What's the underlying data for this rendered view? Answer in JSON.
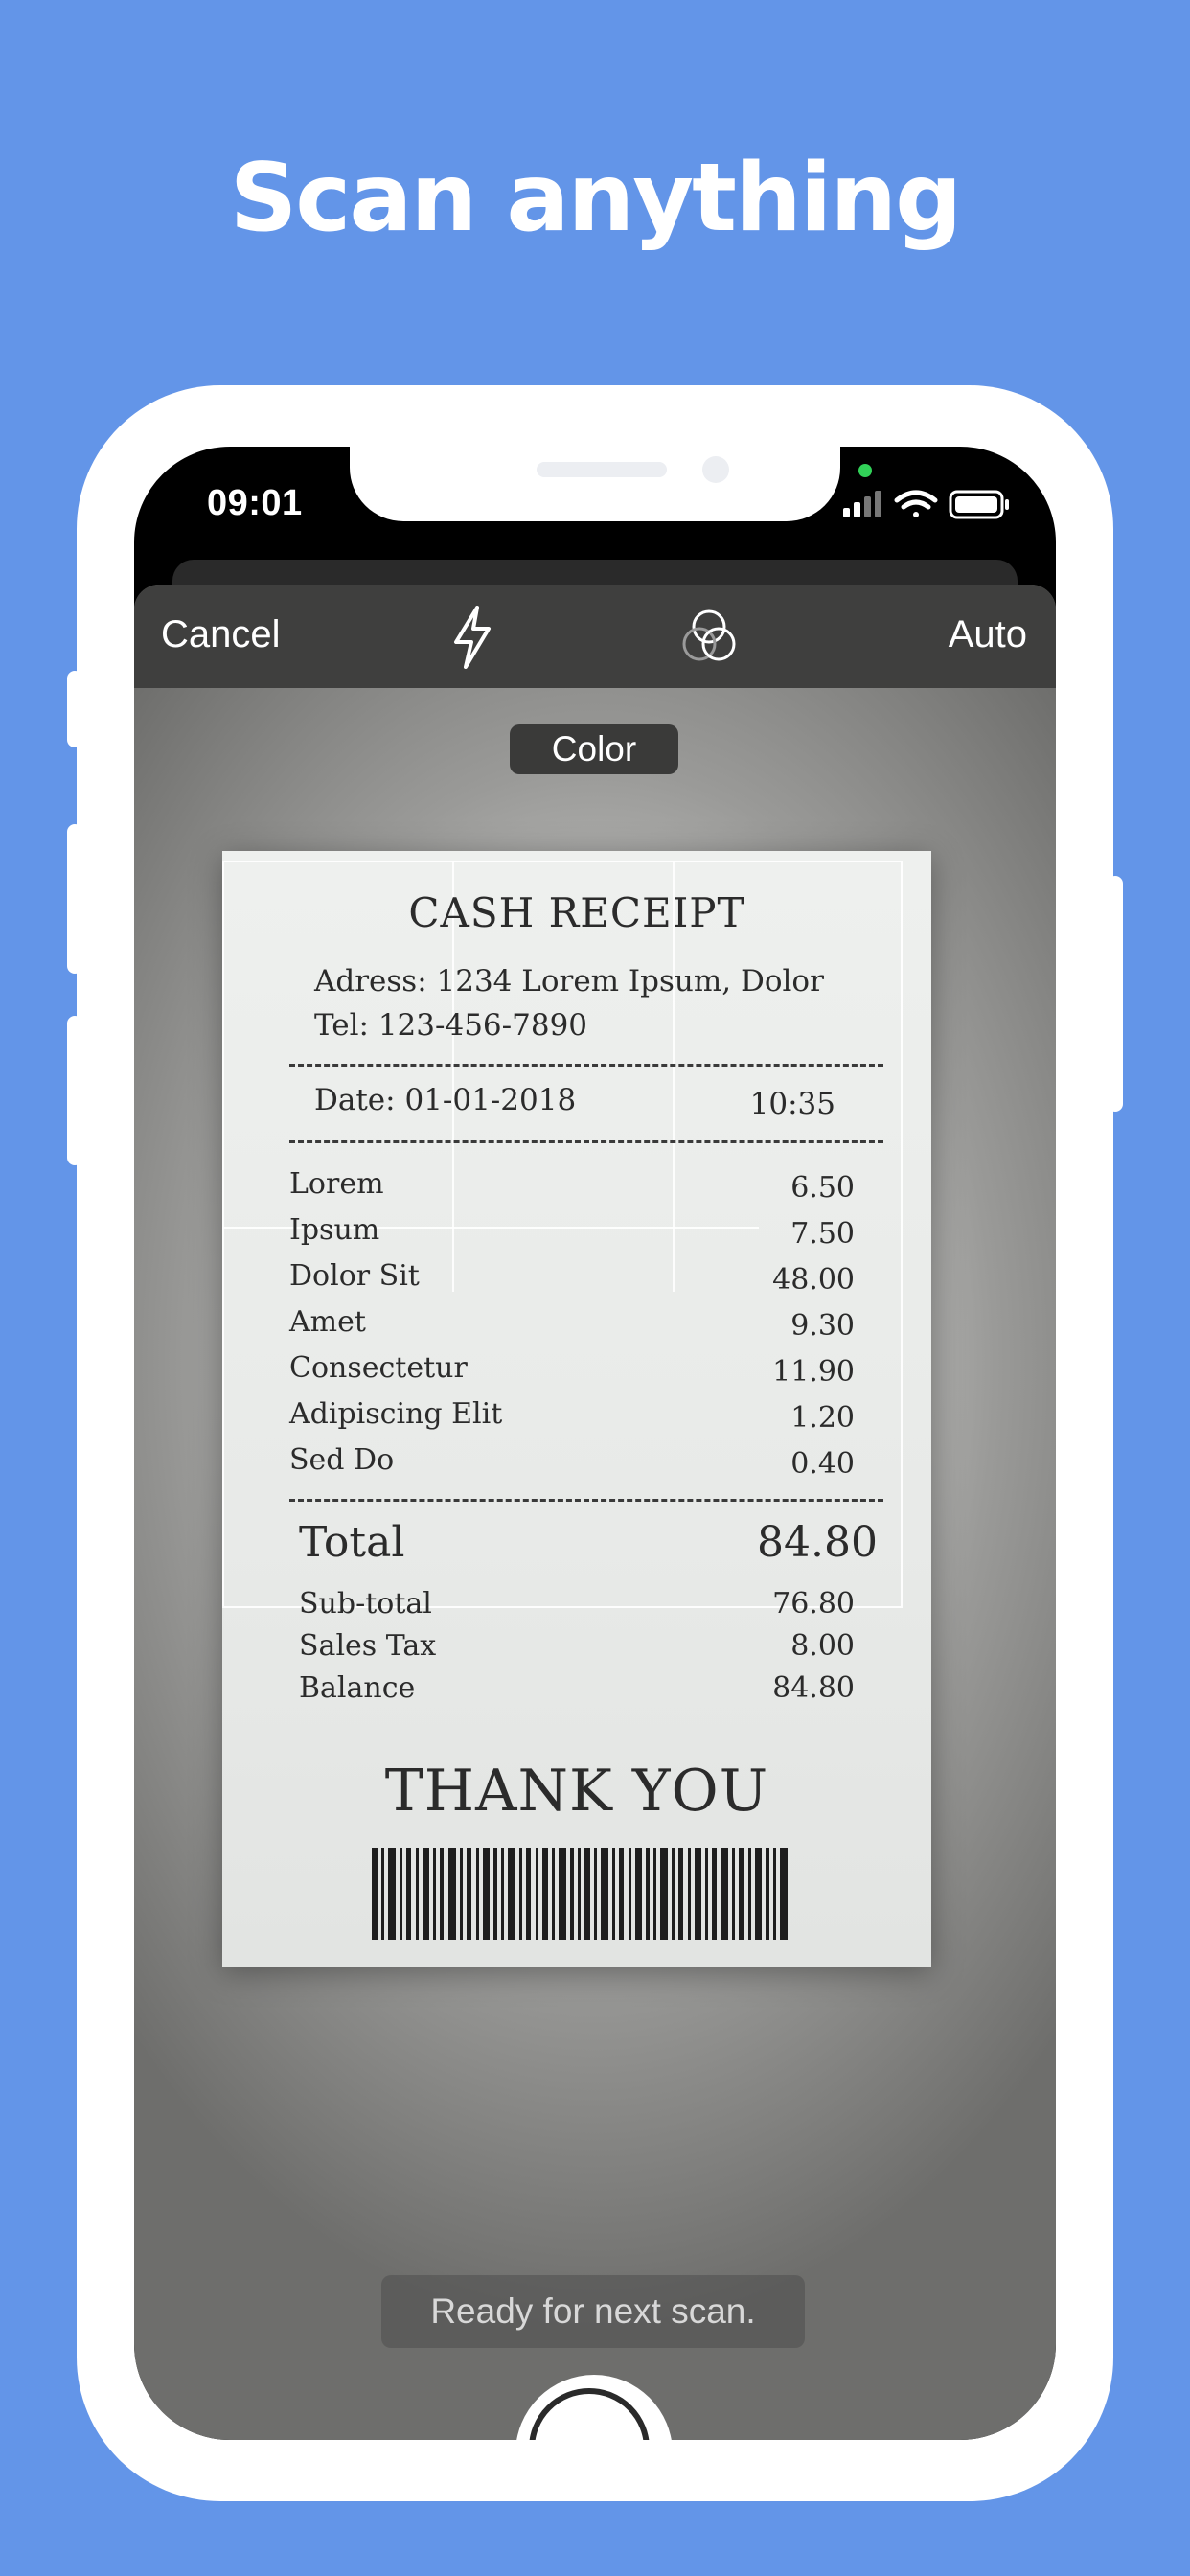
{
  "headline": "Scan anything",
  "status_bar": {
    "time": "09:01"
  },
  "toolbar": {
    "cancel_label": "Cancel",
    "auto_label": "Auto",
    "flash_icon": "flash-icon",
    "filter_icon": "filter-icon"
  },
  "mode_label": "Color",
  "receipt": {
    "title": "CASH RECEIPT",
    "address": "Adress: 1234 Lorem Ipsum, Dolor",
    "tel": "Tel: 123-456-7890",
    "date": "Date: 01-01-2018",
    "time": "10:35",
    "items": [
      {
        "name": "Lorem",
        "price": "6.50"
      },
      {
        "name": "Ipsum",
        "price": "7.50"
      },
      {
        "name": "Dolor Sit",
        "price": "48.00"
      },
      {
        "name": "Amet",
        "price": "9.30"
      },
      {
        "name": "Consectetur",
        "price": "11.90"
      },
      {
        "name": "Adipiscing Elit",
        "price": "1.20"
      },
      {
        "name": "Sed Do",
        "price": "0.40"
      }
    ],
    "total_label": "Total",
    "total_value": "84.80",
    "summary": [
      {
        "name": "Sub-total",
        "price": "76.80"
      },
      {
        "name": "Sales Tax",
        "price": "8.00"
      },
      {
        "name": "Balance",
        "price": "84.80"
      }
    ],
    "thanks": "THANK YOU"
  },
  "scan_status": "Ready for next scan.",
  "colors": {
    "background": "#6395e8",
    "phone_body": "#ffffff",
    "toolbar": "#3f3f3e"
  }
}
